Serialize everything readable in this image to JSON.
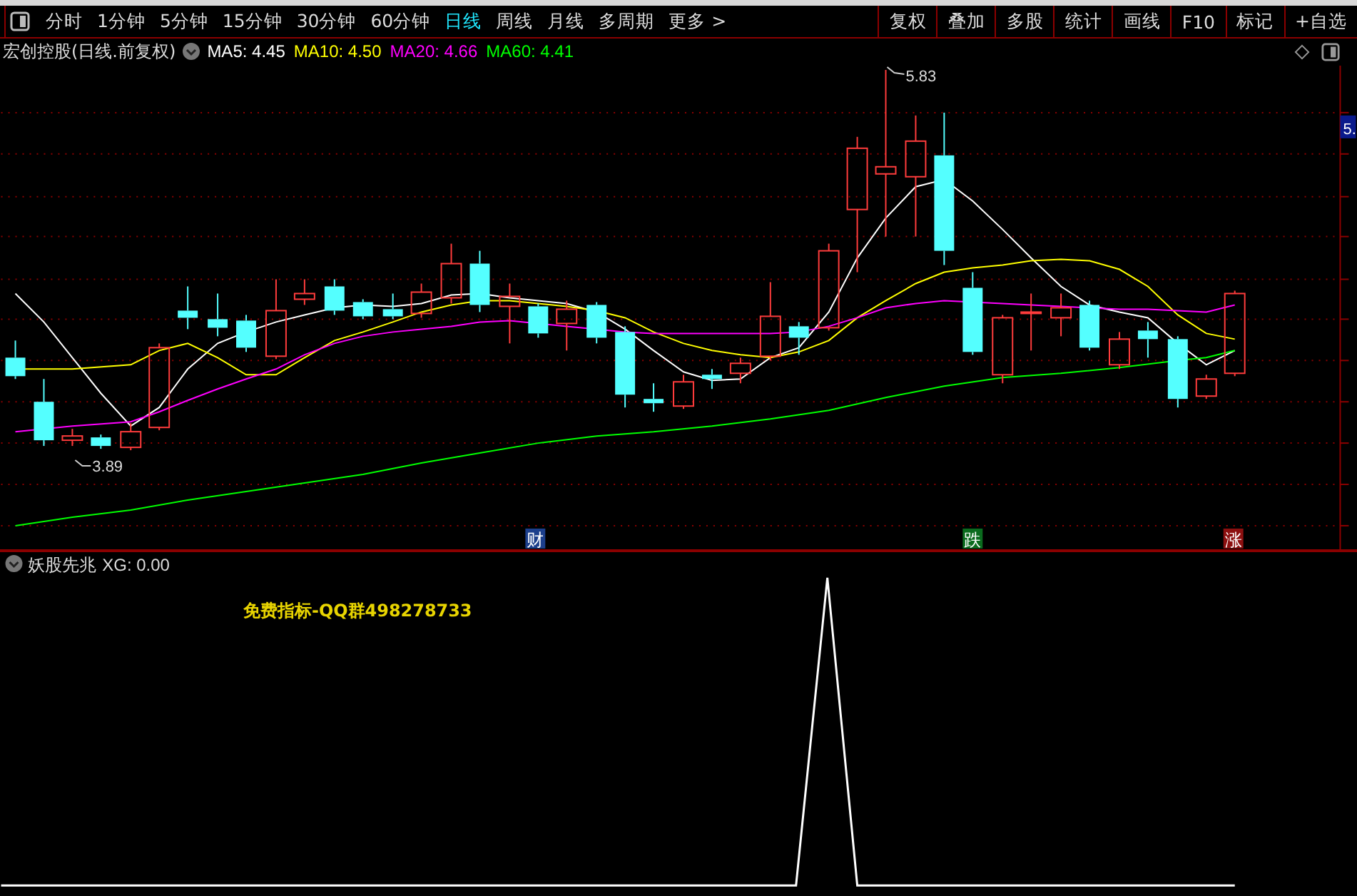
{
  "toolbar": {
    "tabs": [
      {
        "label": "分时",
        "selected": false
      },
      {
        "label": "1分钟",
        "selected": false
      },
      {
        "label": "5分钟",
        "selected": false
      },
      {
        "label": "15分钟",
        "selected": false
      },
      {
        "label": "30分钟",
        "selected": false
      },
      {
        "label": "60分钟",
        "selected": false
      },
      {
        "label": "日线",
        "selected": true
      },
      {
        "label": "周线",
        "selected": false
      },
      {
        "label": "月线",
        "selected": false
      },
      {
        "label": "多周期",
        "selected": false
      },
      {
        "label": "更多 >",
        "selected": false
      }
    ],
    "buttons": [
      "复权",
      "叠加",
      "多股",
      "统计",
      "画线",
      "F10",
      "标记",
      "+自选"
    ]
  },
  "chart": {
    "title": "宏创控股(日线.前复权)",
    "ma": [
      {
        "label": "MA5: 4.45",
        "color": "#ffffff"
      },
      {
        "label": "MA10: 4.50",
        "color": "#ffff00"
      },
      {
        "label": "MA20: 4.66",
        "color": "#ff00ff"
      },
      {
        "label": "MA60: 4.41",
        "color": "#00ff00"
      }
    ],
    "high_label": "5.83",
    "low_label": "3.89",
    "axis_label": "5.",
    "markers": [
      {
        "label": "财",
        "color": "#1c3f8c"
      },
      {
        "label": "跌",
        "color": "#0b6b1e"
      },
      {
        "label": "涨",
        "color": "#8c1010"
      }
    ]
  },
  "indicator": {
    "title": "妖股先兆",
    "reading": "XG: 0.00",
    "note": "免费指标-QQ群498278733"
  }
}
